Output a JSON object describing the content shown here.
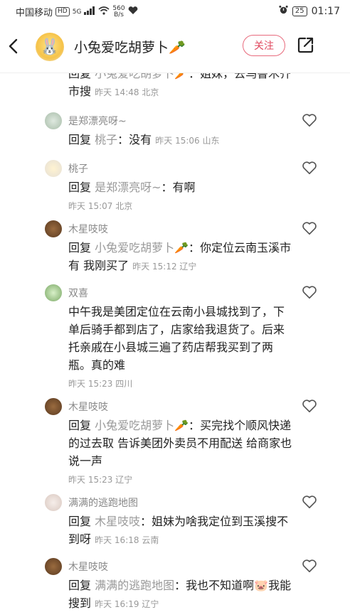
{
  "status_bar": {
    "carrier": "中国移动",
    "hd": "HD",
    "signal": "5G",
    "speed": "560",
    "speed_unit": "B/s",
    "battery": "25",
    "time": "01:17"
  },
  "header": {
    "title": "小兔爱吃胡萝卜🥕",
    "follow_label": "关注"
  },
  "comments": [
    {
      "name": "",
      "prefix": "回复",
      "mention": "小兔爱吃胡萝卜🥕",
      "sep": "：",
      "text": "姐妹，去乌鲁木齐市搜",
      "meta": "昨天 14:48 北京"
    },
    {
      "name": "是郑漂亮呀~",
      "prefix": "回复",
      "mention": "桃子",
      "sep": "：",
      "text": "没有",
      "meta": "昨天 15:06 山东"
    },
    {
      "name": "桃子",
      "prefix": "回复",
      "mention": "是郑漂亮呀~",
      "sep": "：",
      "text": "有啊",
      "meta": "昨天 15:07 北京"
    },
    {
      "name": "木星吱吱",
      "prefix": "回复",
      "mention": "小兔爱吃胡萝卜🥕",
      "sep": "：",
      "text": "你定位云南玉溪市 有 我刚买了",
      "meta": "昨天 15:12 辽宁"
    },
    {
      "name": "双喜",
      "prefix": "",
      "mention": "",
      "sep": "",
      "text": "中午我是美团定位在云南小县城找到了，下单后骑手都到店了，店家给我退货了。后来托亲戚在小县城三遍了药店帮我买到了两瓶。真的难",
      "meta": "昨天 15:23 四川"
    },
    {
      "name": "木星吱吱",
      "prefix": "回复",
      "mention": "小兔爱吃胡萝卜🥕",
      "sep": "：",
      "text": "买完找个顺风快递的过去取 告诉美团外卖员不用配送 给商家也说一声",
      "meta": "昨天 15:23 辽宁"
    },
    {
      "name": "满满的逃跑地图",
      "prefix": "回复",
      "mention": "木星吱吱",
      "sep": "：",
      "text": "姐妹为啥我定位到玉溪搜不到呀",
      "meta": "昨天 16:18 云南"
    },
    {
      "name": "木星吱吱",
      "prefix": "回复",
      "mention": "满满的逃跑地图",
      "sep": "：",
      "text": "我也不知道啊🐷我能搜到",
      "meta": "昨天 16:19 辽宁"
    }
  ],
  "colors": {
    "accent": "#e0485e",
    "muted": "#999999",
    "text": "#222222"
  }
}
